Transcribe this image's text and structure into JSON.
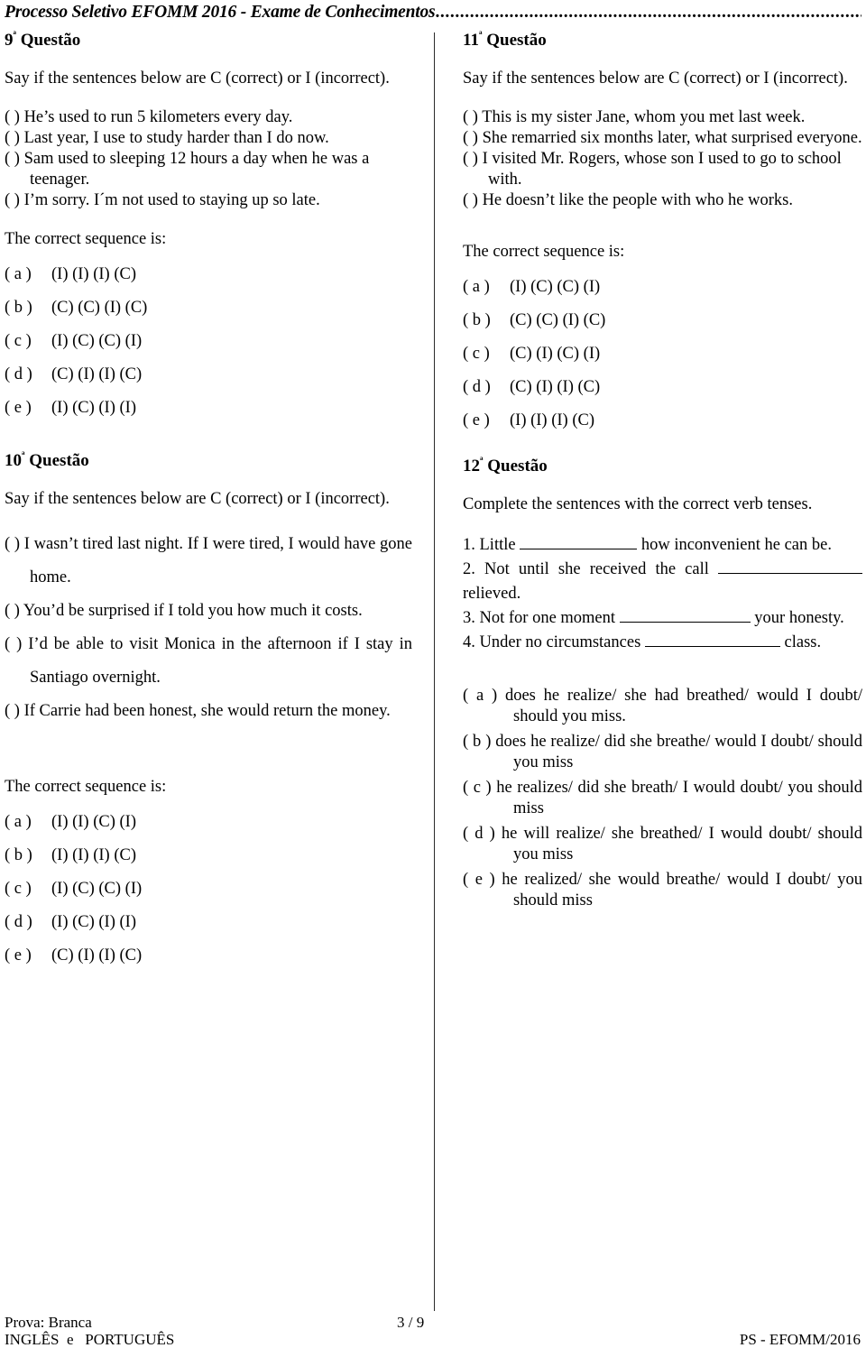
{
  "header": {
    "title": "Processo Seletivo EFOMM 2016 - Exame de Conhecimentos",
    "leader": "............................................................................................"
  },
  "questions": {
    "q9": {
      "heading_number": "9",
      "heading_ordinal": "ª",
      "heading_word": "Questão",
      "instruction": "Say if the sentences below are C (correct) or I (incorrect).",
      "statements": [
        "(  )  He’s used to run 5 kilometers every day.",
        "(  )  Last year, I use to study harder than I do now.",
        "(  )  Sam used to sleeping 12 hours a day when he was a teenager.",
        "(  )  I’m sorry. I´m not used to staying up so late."
      ],
      "sequence_label": "The correct sequence is:",
      "options": [
        {
          "tag": "( a )",
          "value": "(I) (I) (I) (C)"
        },
        {
          "tag": "( b )",
          "value": "(C) (C) (I) (C)"
        },
        {
          "tag": "( c )",
          "value": "(I) (C) (C) (I)"
        },
        {
          "tag": "( d )",
          "value": "(C) (I) (I) (C)"
        },
        {
          "tag": "( e )",
          "value": "(I) (C) (I) (I)"
        }
      ]
    },
    "q10": {
      "heading_number": "10",
      "heading_ordinal": "ª",
      "heading_word": "Questão",
      "instruction": "Say if the sentences below are C (correct) or I (incorrect).",
      "statements": [
        "(  ) I wasn’t tired last night. If I were tired, I would have gone home.",
        "(  ) You’d be surprised if I told you how much it costs.",
        "(  ) I’d be able to visit Monica in the afternoon if I stay in Santiago overnight.",
        "(  ) If Carrie had been honest, she would return the money."
      ],
      "sequence_label": "The correct sequence is:",
      "options": [
        {
          "tag": "( a )",
          "value": "(I) (I) (C) (I)"
        },
        {
          "tag": "( b )",
          "value": "(I) (I) (I) (C)"
        },
        {
          "tag": "( c )",
          "value": "(I) (C) (C) (I)"
        },
        {
          "tag": "( d )",
          "value": "(I) (C) (I) (I)"
        },
        {
          "tag": "( e )",
          "value": "(C) (I) (I) (C)"
        }
      ]
    },
    "q11": {
      "heading_number": "11",
      "heading_ordinal": "ª",
      "heading_word": "Questão",
      "instruction": "Say if the sentences below are C (correct) or I (incorrect).",
      "statements": [
        "(  ) This is my sister Jane, whom you met last week.",
        "(  ) She remarried six months later, what surprised everyone.",
        "(  ) I visited Mr. Rogers, whose son I used to go to school with.",
        "(  ) He doesn’t like the people with who he works."
      ],
      "sequence_label": "The correct sequence is:",
      "options": [
        {
          "tag": "( a )",
          "value": "(I) (C) (C) (I)"
        },
        {
          "tag": "( b )",
          "value": "(C) (C) (I) (C)"
        },
        {
          "tag": "( c )",
          "value": "(C) (I) (C) (I)"
        },
        {
          "tag": "( d )",
          "value": "(C) (I) (I) (C)"
        },
        {
          "tag": "( e )",
          "value": "(I) (I) (I) (C)"
        }
      ]
    },
    "q12": {
      "heading_number": "12",
      "heading_ordinal": "ª",
      "heading_word": "Questão",
      "instruction": "Complete the sentences with the correct verb tenses.",
      "items": [
        {
          "num": "1.",
          "before": "Little",
          "after": "how inconvenient he can be."
        },
        {
          "num": "2.",
          "before": "Not until she received the call",
          "after": "relieved."
        },
        {
          "num": "3.",
          "before": "Not for one moment",
          "after": "your honesty."
        },
        {
          "num": "4.",
          "before": "Under no circumstances",
          "after": "class."
        }
      ],
      "options": [
        {
          "tag": "( a )",
          "value": "does he realize/ she had breathed/ would I doubt/ should you miss."
        },
        {
          "tag": "( b )",
          "value": "does he realize/ did she breathe/ would I doubt/ should you miss"
        },
        {
          "tag": "( c )",
          "value": "he realizes/ did she breath/  I would doubt/ you should miss"
        },
        {
          "tag": "( d )",
          "value": "he will realize/ she breathed/ I would doubt/ should  you miss"
        },
        {
          "tag": "( e )",
          "value": "he realized/ she would breathe/ would I doubt/ you should miss"
        }
      ]
    }
  },
  "footer": {
    "exam_version": "Prova: Branca",
    "subjects": "INGLÊS  e   PORTUGUÊS",
    "page_number": "3 / 9",
    "exam_code": "PS - EFOMM/2016"
  }
}
